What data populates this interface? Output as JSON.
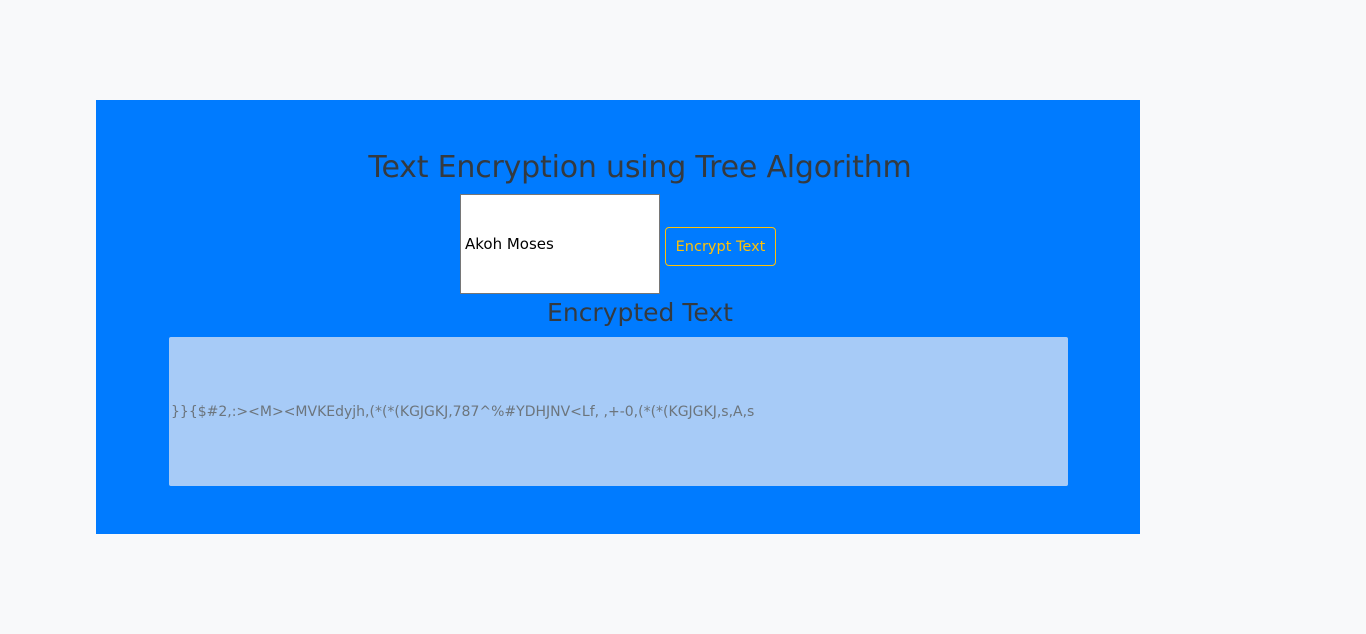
{
  "page": {
    "title": "Text Encryption using Tree Algorithm",
    "input_value": "Akoh Moses",
    "encrypt_button_label": "Encrypt Text",
    "output_heading": "Encrypted Text",
    "output_value": "}}{$#2,:><M><MVKEdyjh,(*(*(KGJGKJ,787^%#YDHJNV<Lf, ,+-0,(*(*(KGJGKJ,s,A,s"
  },
  "colors": {
    "page_background": "#f8f9fa",
    "panel_background": "#007bff",
    "heading_text": "#343a40",
    "button_accent": "#ffc107",
    "output_background": "#a7cbf7",
    "output_text": "#6c757d"
  }
}
